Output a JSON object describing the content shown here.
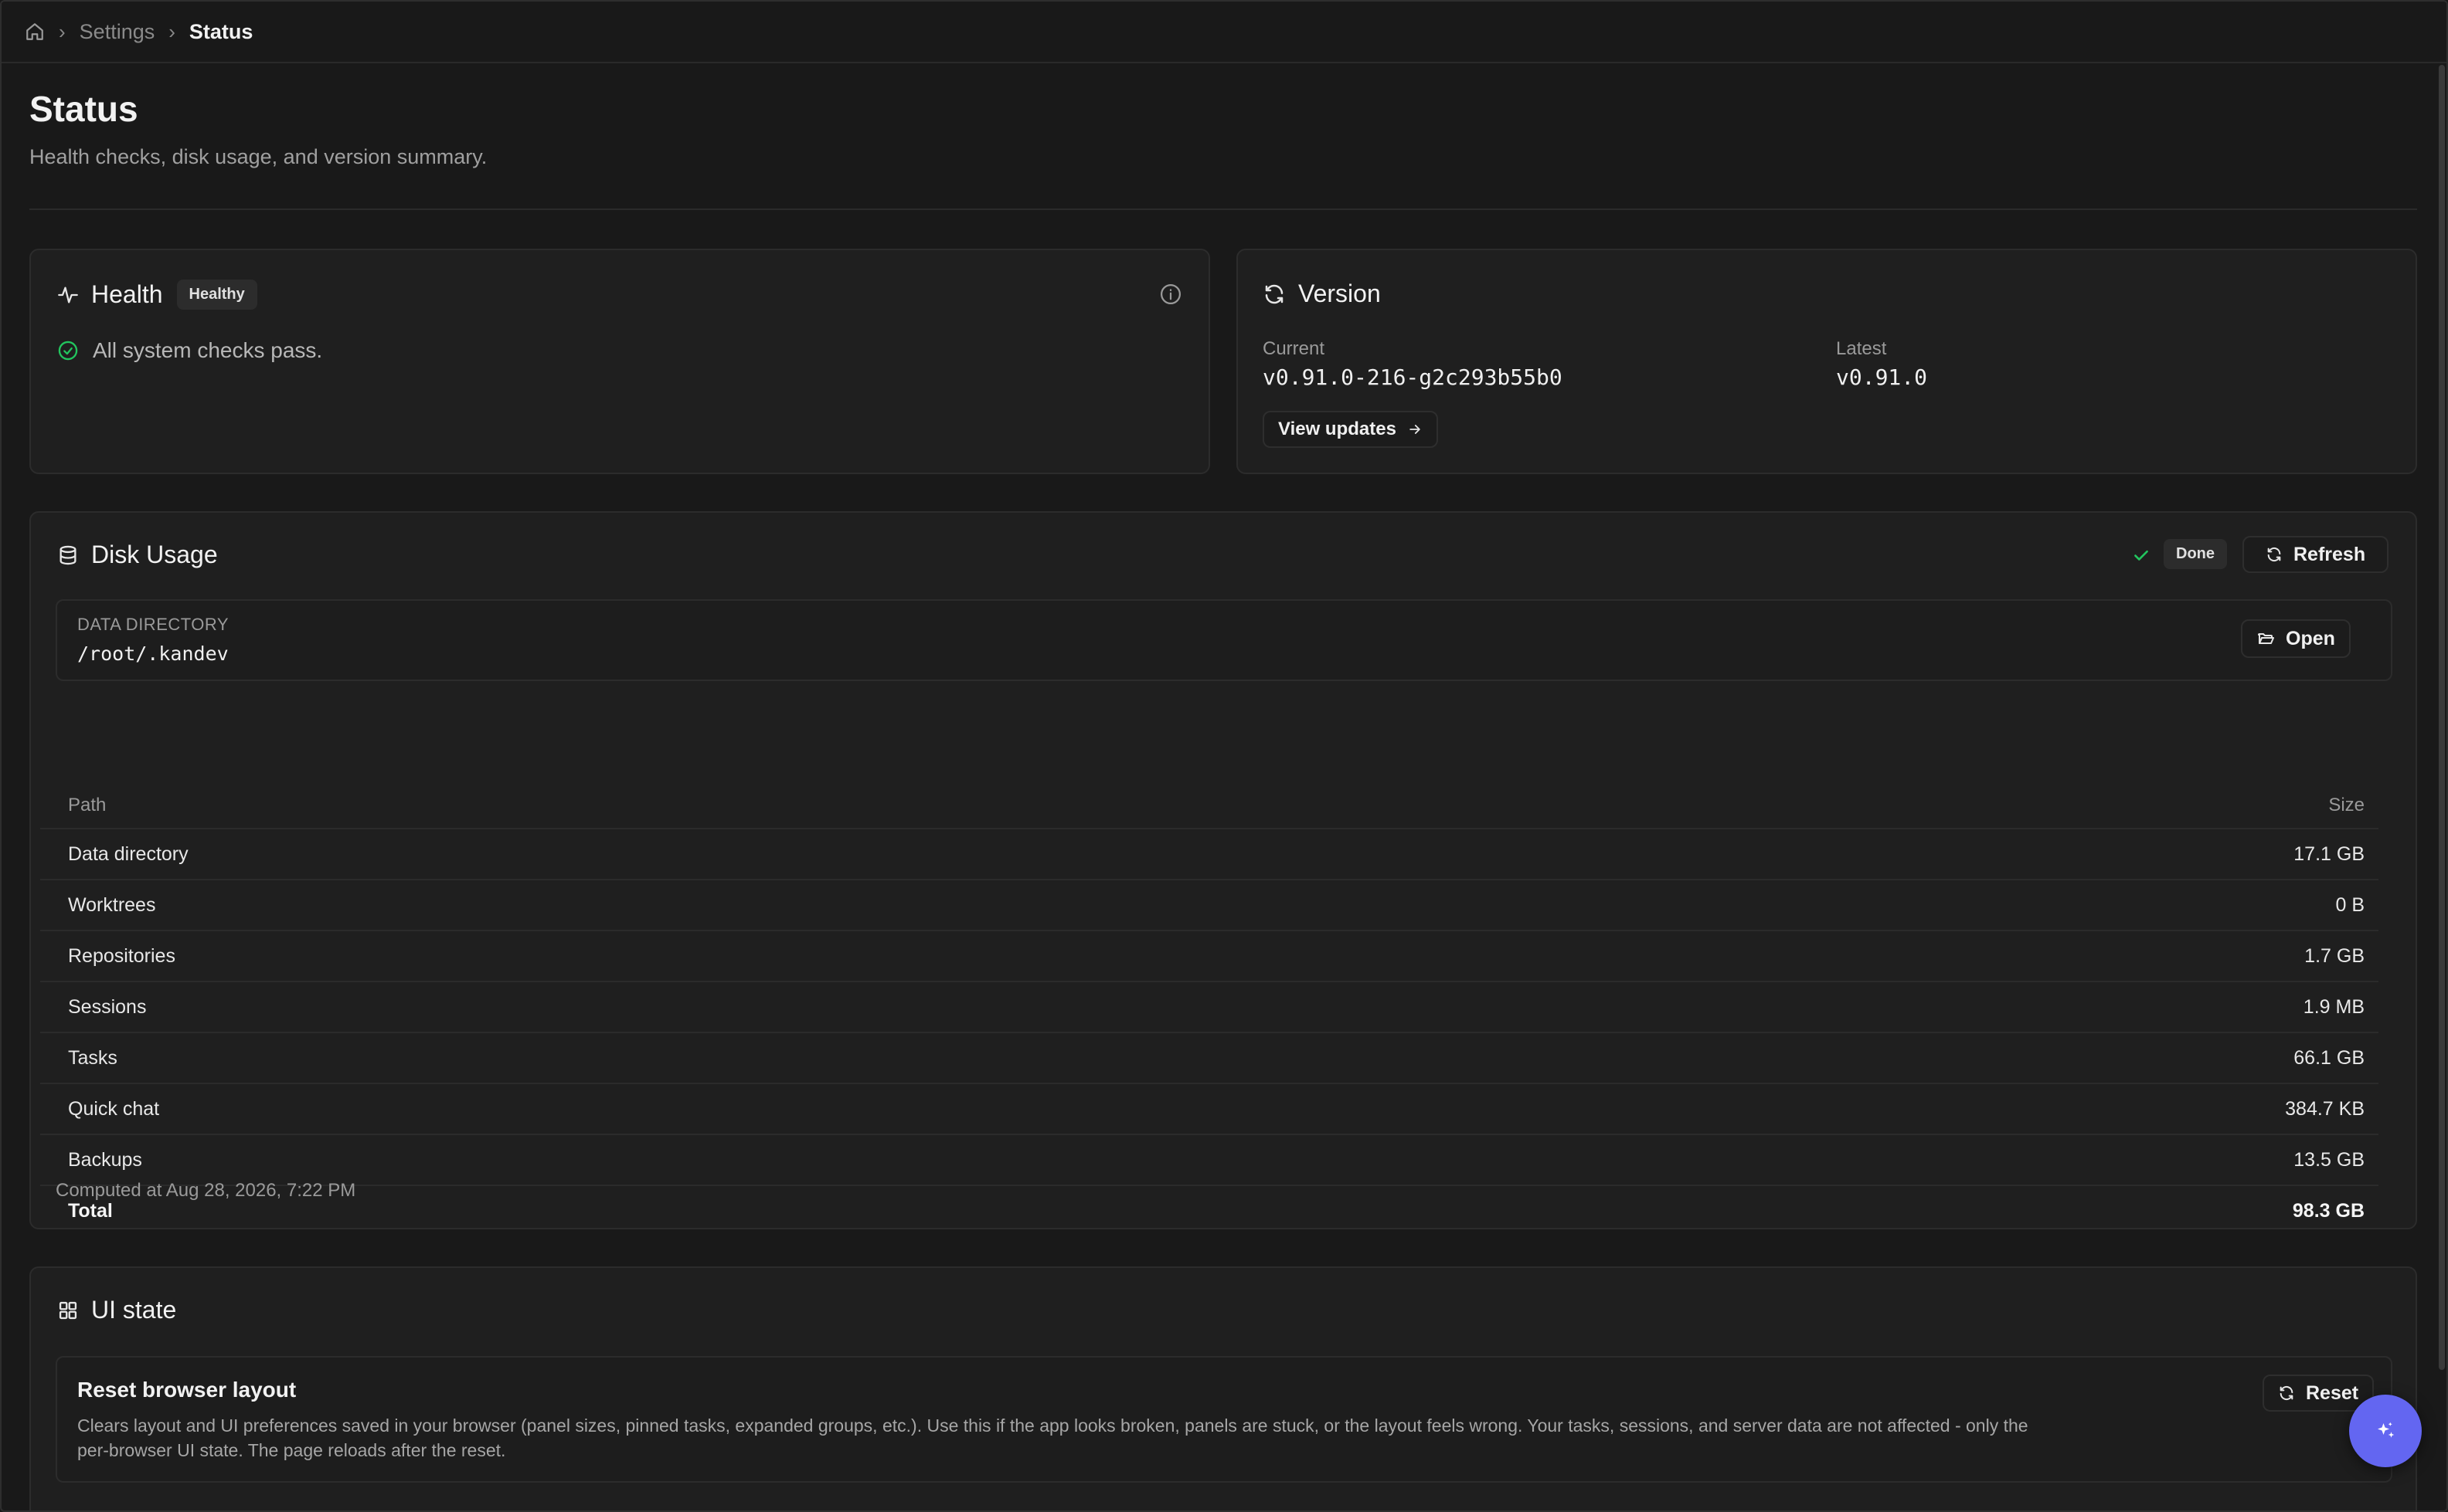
{
  "breadcrumb": {
    "items": [
      "Settings",
      "Status"
    ]
  },
  "page": {
    "title": "Status",
    "subtitle": "Health checks, disk usage, and version summary."
  },
  "health": {
    "title": "Health",
    "badge": "Healthy",
    "message": "All system checks pass."
  },
  "version": {
    "title": "Version",
    "current_label": "Current",
    "current_value": "v0.91.0-216-g2c293b55b0",
    "latest_label": "Latest",
    "latest_value": "v0.91.0",
    "view_updates_label": "View updates"
  },
  "disk": {
    "title": "Disk Usage",
    "status_badge": "Done",
    "refresh_label": "Refresh",
    "data_dir_label": "DATA DIRECTORY",
    "data_dir_path": "/root/.kandev",
    "open_label": "Open",
    "columns": {
      "path": "Path",
      "size": "Size"
    },
    "rows": [
      {
        "path": "Data directory",
        "size": "17.1 GB"
      },
      {
        "path": "Worktrees",
        "size": "0 B"
      },
      {
        "path": "Repositories",
        "size": "1.7 GB"
      },
      {
        "path": "Sessions",
        "size": "1.9 MB"
      },
      {
        "path": "Tasks",
        "size": "66.1 GB"
      },
      {
        "path": "Quick chat",
        "size": "384.7 KB"
      },
      {
        "path": "Backups",
        "size": "13.5 GB"
      }
    ],
    "total": {
      "path": "Total",
      "size": "98.3 GB"
    },
    "computed_at": "Computed at Aug 28, 2026, 7:22 PM"
  },
  "ui_state": {
    "title": "UI state",
    "reset_title": "Reset browser layout",
    "reset_desc_line1": "Clears layout and UI preferences saved in your browser (panel sizes, pinned tasks, expanded groups, etc.). Use this if the app looks broken, panels are stuck, or the layout feels wrong. Your tasks, sessions, and server data are not affected - only the",
    "reset_desc_line2": "per-browser UI state. The page reloads after the reset.",
    "reset_label": "Reset"
  },
  "colors": {
    "accent": "#6366f1",
    "success": "#22c55e",
    "background": "#191919",
    "card": "#1f1f1f"
  }
}
